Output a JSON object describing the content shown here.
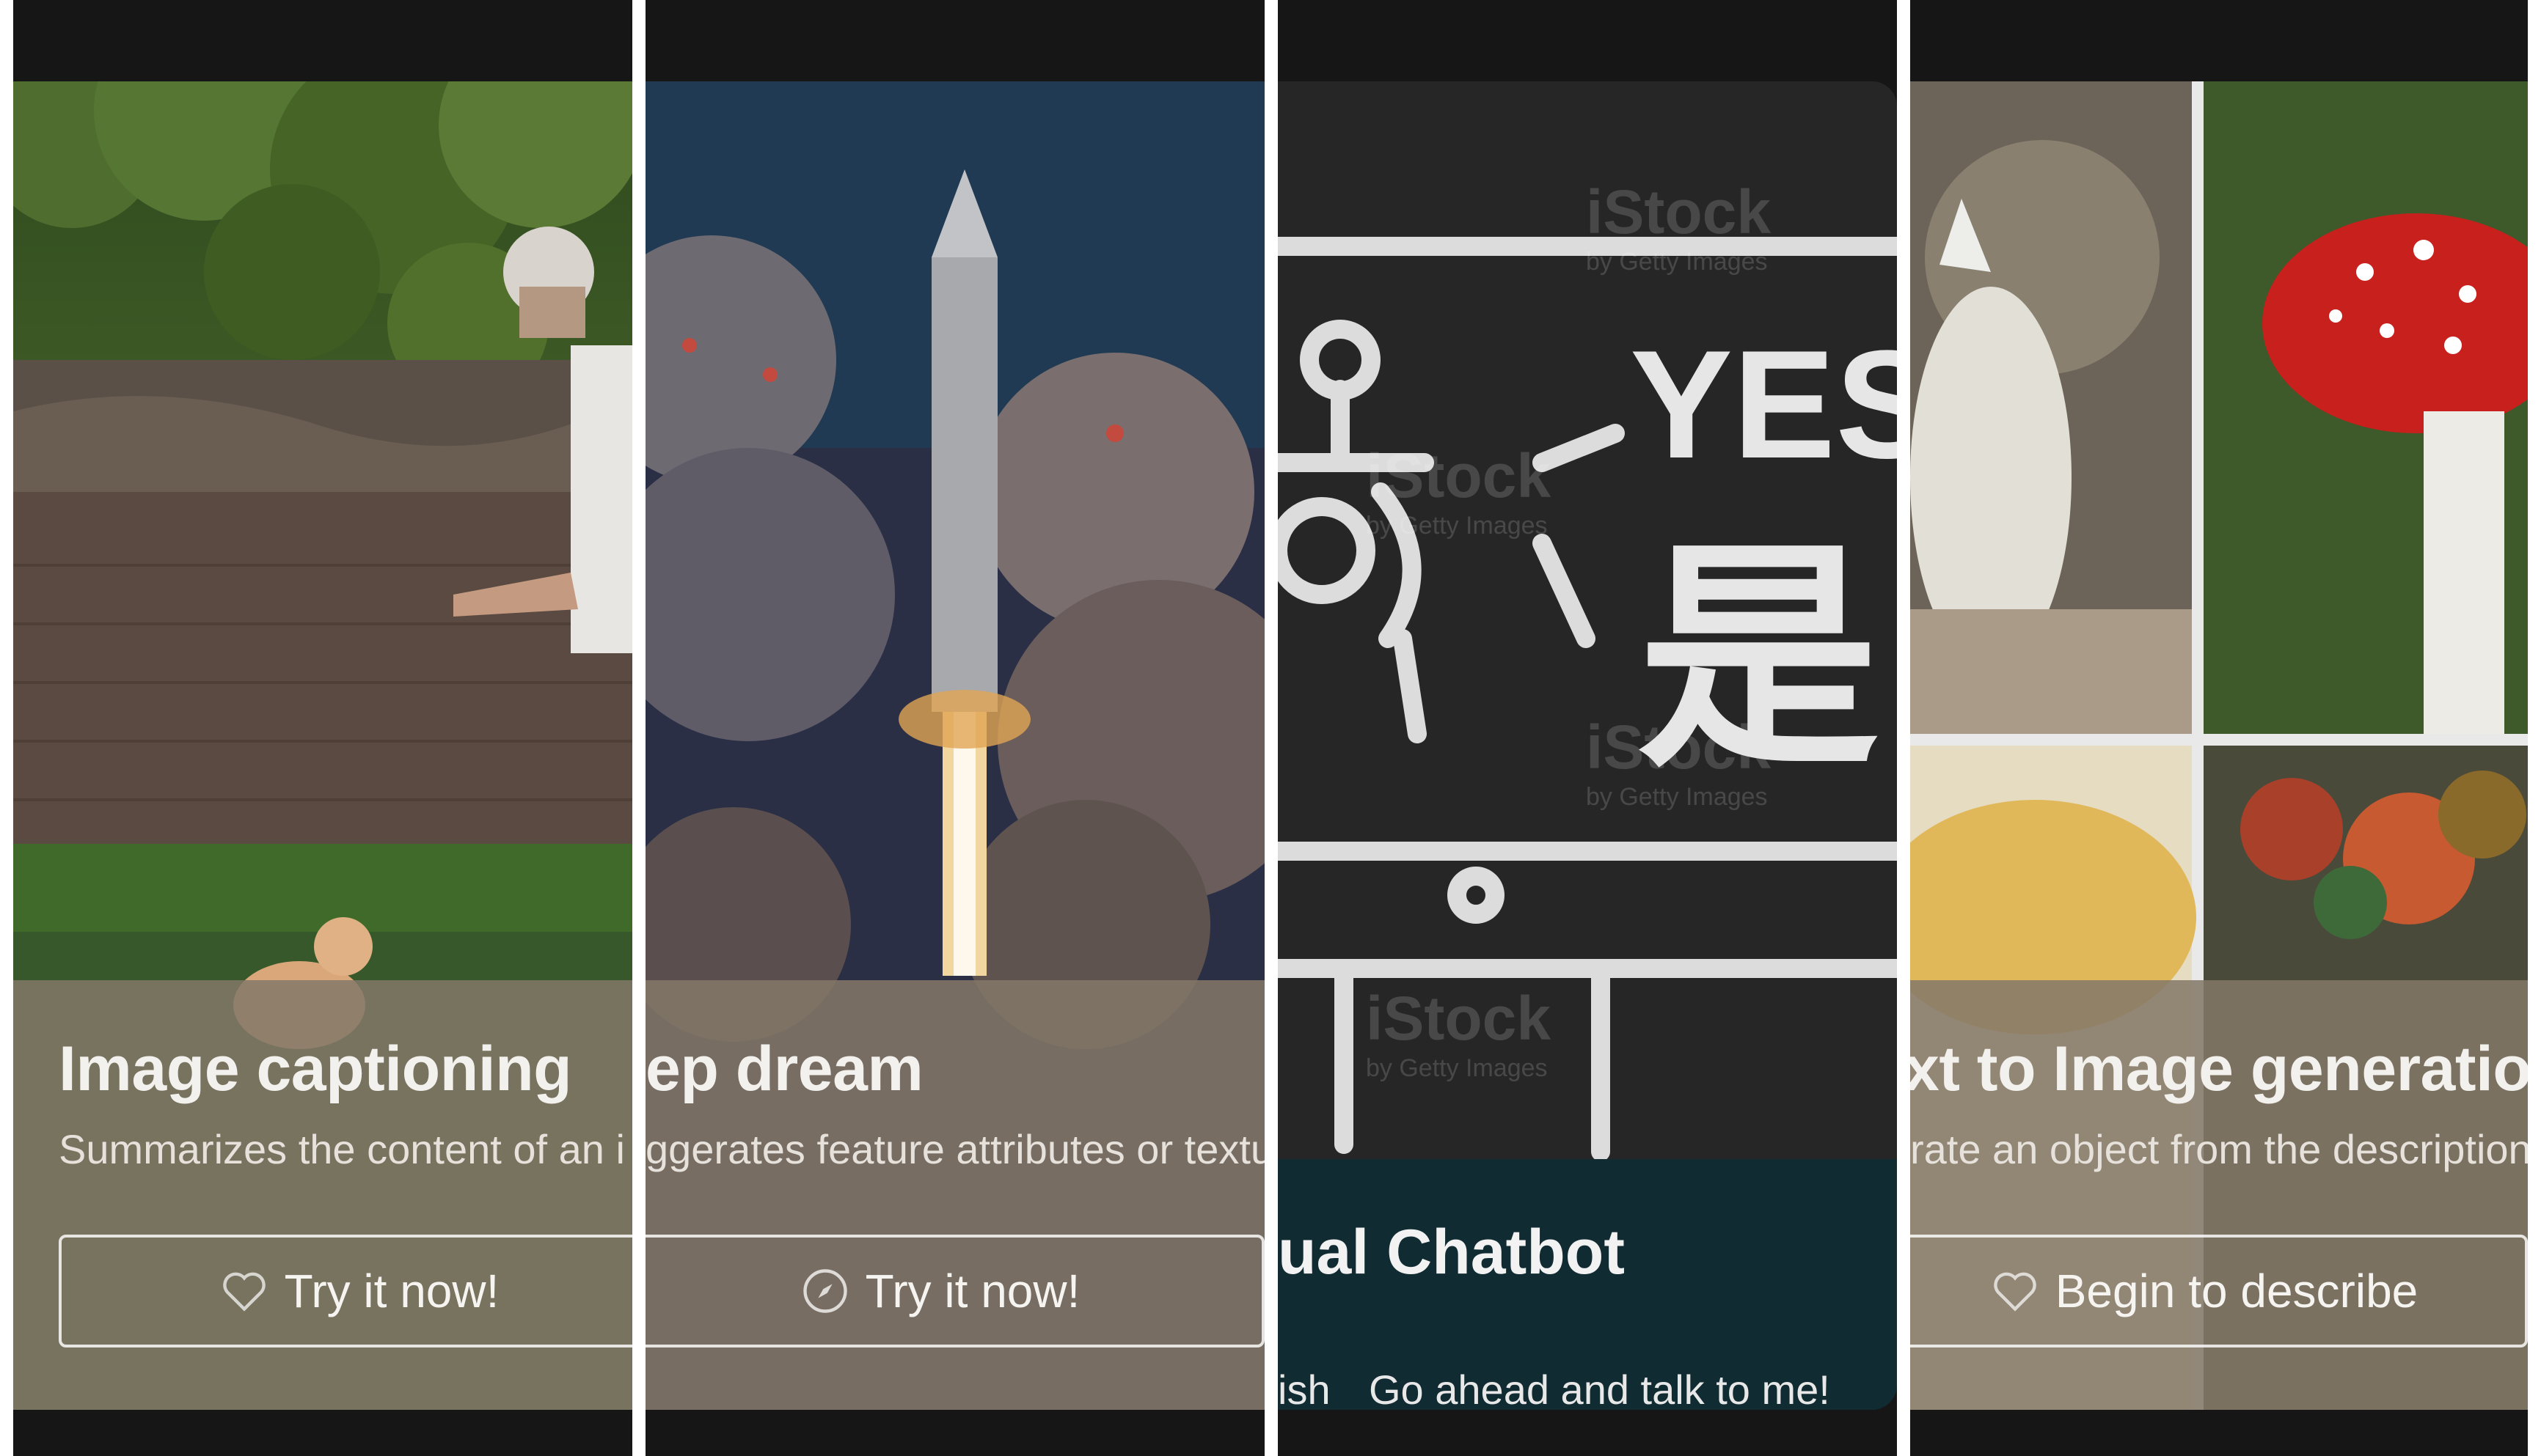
{
  "panels": [
    {
      "title": "Image captioning",
      "subtitle": "Summarizes the content of an i",
      "cta_label": "Try it now!",
      "cta_icon": "heart-icon"
    },
    {
      "title": "ep dream",
      "subtitle": "ggerates feature attributes or textu",
      "cta_label": "Try it now!",
      "cta_icon": "compass-icon"
    },
    {
      "title": "ual Chatbot",
      "subtitle_left": "ish",
      "subtitle_right": "Go ahead and talk to me!",
      "board_text_yes": "YES",
      "board_text_char": "是",
      "watermark_brand": "iStock",
      "watermark_sub": "by Getty Images"
    },
    {
      "title": "xt to Image generation",
      "subtitle": "rate an object from the description",
      "cta_label": "Begin to describe",
      "cta_icon": "heart-icon"
    }
  ],
  "colors": {
    "overlay": "#847868",
    "chatbot_footer": "#102b32",
    "frame_background": "#161616",
    "divider": "#ffffff"
  }
}
